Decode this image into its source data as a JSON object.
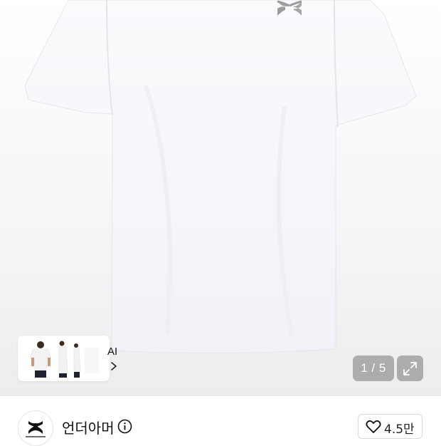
{
  "product": {
    "image_index_label": "1 / 5",
    "image_alt": "white t-shirt"
  },
  "ai_card": {
    "label": "AI",
    "chevron_icon": "chevron-right-icon"
  },
  "store": {
    "name": "언더아머",
    "logo_icon": "under-armour-logo",
    "info_icon": "info-icon",
    "like_icon": "heart-outline-icon",
    "like_count": "4.5만"
  },
  "colors": {
    "shirt": "#f6f6fb",
    "logo_gray": "#9a9ca0",
    "overlay": "#76767a"
  }
}
